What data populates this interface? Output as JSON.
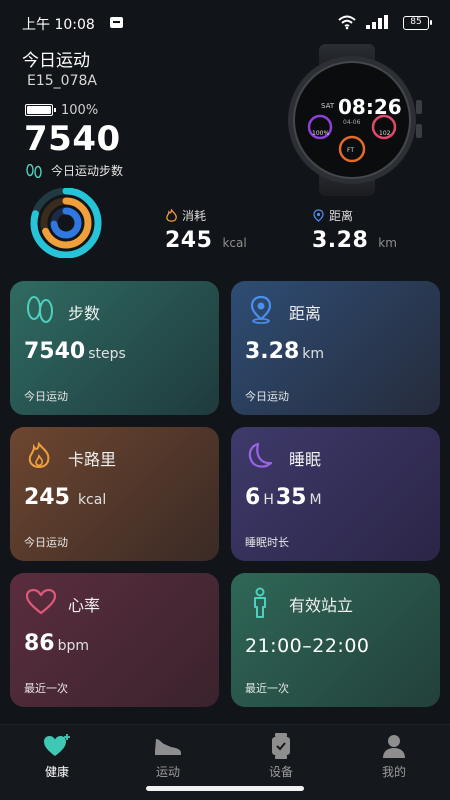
{
  "status_bar": {
    "time": "上午 10:08",
    "battery": "85"
  },
  "header": {
    "title": "今日运动",
    "device": "E15_078A",
    "battery_percent": "100%",
    "steps": "7540",
    "steps_label": "今日运动步数"
  },
  "watch": {
    "time": "08:26",
    "day": "SAT",
    "date": "04-06",
    "left_value": "100%",
    "right_value": "102",
    "bottom_value": "FT"
  },
  "summary": {
    "calories": {
      "label": "消耗",
      "value": "245",
      "unit": "kcal"
    },
    "distance": {
      "label": "距离",
      "value": "3.28",
      "unit": "km"
    }
  },
  "cards": {
    "steps": {
      "title": "步数",
      "value": "7540",
      "unit": "steps",
      "sub": "今日运动"
    },
    "distance": {
      "title": "距离",
      "value": "3.28",
      "unit": "km",
      "sub": "今日运动"
    },
    "calories": {
      "title": "卡路里",
      "value": "245",
      "unit": "kcal",
      "sub": "今日运动"
    },
    "sleep": {
      "title": "睡眠",
      "hours": "6",
      "h_unit": "H",
      "minutes": "35",
      "m_unit": "M",
      "sub": "睡眠时长"
    },
    "heart": {
      "title": "心率",
      "value": "86",
      "unit": "bpm",
      "sub": "最近一次"
    },
    "stand": {
      "title": "有效站立",
      "value": "21:00–22:00",
      "sub": "最近一次"
    }
  },
  "nav": [
    {
      "label": "健康",
      "icon": "heart-plus-icon",
      "active": true
    },
    {
      "label": "运动",
      "icon": "shoe-icon",
      "active": false
    },
    {
      "label": "设备",
      "icon": "watch-icon",
      "active": false
    },
    {
      "label": "我的",
      "icon": "person-icon",
      "active": false
    }
  ],
  "colors": {
    "background": "#111418",
    "accent_teal": "#3fc9b5",
    "ring_blue": "#2f78e0",
    "ring_orange": "#f0a03a",
    "ring_cyan": "#27c3d8"
  }
}
